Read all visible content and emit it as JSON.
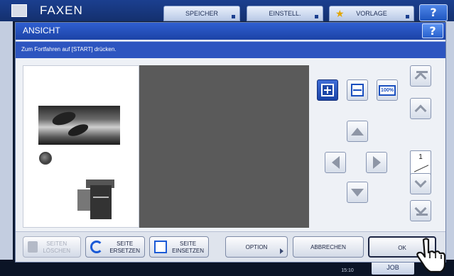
{
  "background": {
    "title": "FAXEN",
    "tabs": [
      "SPEICHER",
      "EINSTELL.",
      "VORLAGE"
    ],
    "help_label": "?",
    "status_clock": "15:10",
    "job_button": "JOB"
  },
  "dialog": {
    "title": "ANSICHT",
    "help_label": "?",
    "message": "Zum Fortfahren auf [START] drücken.",
    "zoom": {
      "fit_page_icon": "fit-page-icon",
      "fit_width_icon": "fit-width-icon",
      "actual_size_label": "100%"
    },
    "page_counter": {
      "current": "1",
      "total": "1"
    },
    "buttons": {
      "delete_pages": "SEITEN\nLÖSCHEN",
      "replace_page": "SEITE\nERSETZEN",
      "insert_page": "SEITE\nEINSETZEN",
      "option": "OPTION",
      "cancel": "ABBRECHEN",
      "ok": "OK"
    }
  },
  "colors": {
    "titlebar": "#1c43a6",
    "message_bar": "#2d55c0",
    "active_button": "#1a44a8",
    "preview_view": "#5a5a5a"
  }
}
